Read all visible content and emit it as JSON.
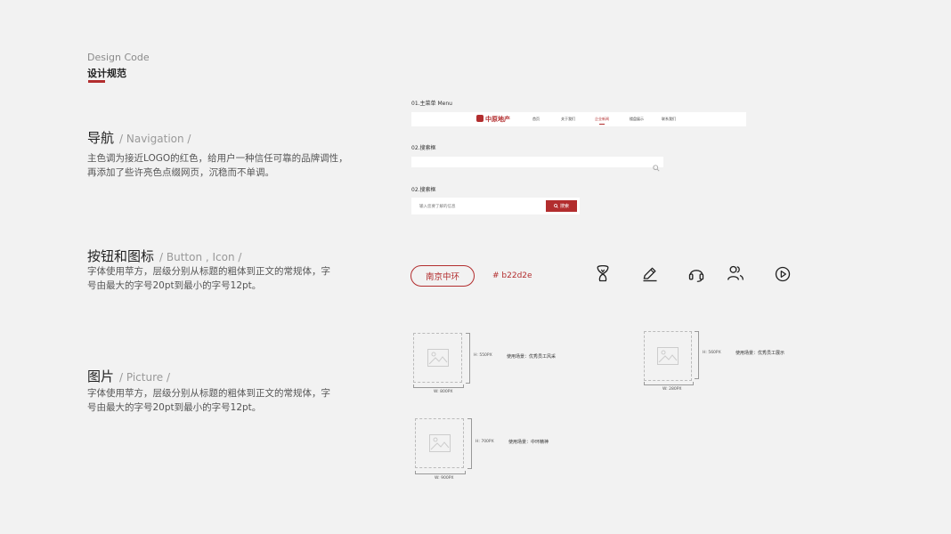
{
  "header": {
    "design_code": "Design Code",
    "title": "设计规范"
  },
  "sections": {
    "nav": {
      "title": "导航",
      "title_en": "/ Navigation /",
      "desc_1": "主色调为接近LOGO的红色，给用户一种信任可靠的品牌调性，",
      "desc_2": "再添加了些许亮色点缀网页，沉稳而不单调。"
    },
    "button": {
      "title": "按钮和图标",
      "title_en": "/ Button ,  Icon /",
      "desc_1": "字体使用苹方，层级分别从标题的粗体到正文的常规体，字",
      "desc_2": "号由最大的字号20pt到最小的字号12pt。"
    },
    "picture": {
      "title": "图片",
      "title_en": "/ Picture /",
      "desc_1": "字体使用苹方，层级分别从标题的粗体到正文的常规体，字",
      "desc_2": "号由最大的字号20pt到最小的字号12pt。"
    }
  },
  "nav_demo": {
    "label": "01.主菜单 Menu",
    "logo": "中原地产",
    "items": [
      "首页",
      "关于我们",
      "企业新闻",
      "楼盘展示",
      "联系我们"
    ],
    "active_index": 2
  },
  "search_demo_1": {
    "label": "02.搜索框"
  },
  "search_demo_2": {
    "label": "02.搜索框",
    "placeholder": "输入您要了解的信息",
    "button": "搜索"
  },
  "button_demo": {
    "label": "南京中环",
    "color_code": "# b22d2e"
  },
  "icons": [
    "trophy-icon",
    "edit-icon",
    "headset-icon",
    "users-icon",
    "play-icon"
  ],
  "pictures": [
    {
      "height": "H: 550PX",
      "width": "W: 800PX",
      "usage": "使用场景：优秀员工风采"
    },
    {
      "height": "H: 560PX",
      "width": "W: 280PX",
      "usage": "使用场景：优秀员工展示"
    },
    {
      "height": "H: 700PX",
      "width": "W: 900PX",
      "usage": "使用场景：中环精神"
    }
  ],
  "colors": {
    "brand": "#b22d2e",
    "background": "#f2f2f2"
  }
}
